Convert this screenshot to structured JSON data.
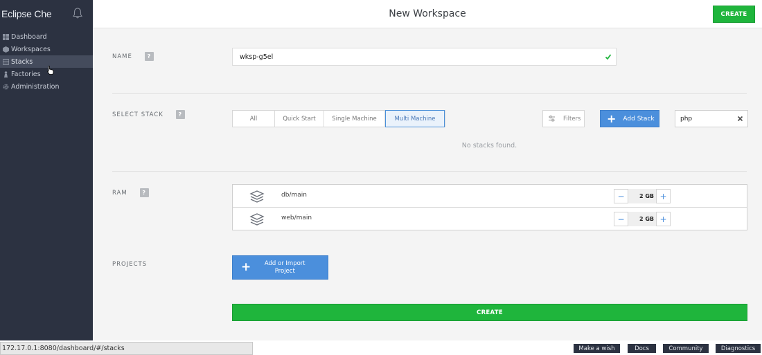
{
  "app": {
    "brand": "Eclipse Che"
  },
  "sidebar": {
    "items": [
      {
        "label": "Dashboard",
        "icon": "dashboard-icon"
      },
      {
        "label": "Workspaces",
        "icon": "workspaces-icon"
      },
      {
        "label": "Stacks",
        "icon": "stacks-icon",
        "active": true
      },
      {
        "label": "Factories",
        "icon": "factories-icon"
      },
      {
        "label": "Administration",
        "icon": "gear-icon"
      }
    ]
  },
  "header": {
    "title": "New Workspace",
    "create_label": "CREATE"
  },
  "name_section": {
    "label": "NAME",
    "help": "?",
    "value": "wksp-g5el"
  },
  "stack_section": {
    "label": "SELECT STACK",
    "help": "?",
    "tabs": [
      "All",
      "Quick Start",
      "Single Machine",
      "Multi Machine"
    ],
    "active_tab": "Multi Machine",
    "filters_label": "Filters",
    "add_stack_label": "Add Stack",
    "search_value": "php",
    "empty_message": "No stacks found."
  },
  "ram_section": {
    "label": "RAM",
    "help": "?",
    "machines": [
      {
        "name": "db/main",
        "ram": "2 GB"
      },
      {
        "name": "web/main",
        "ram": "2 GB"
      }
    ]
  },
  "projects_section": {
    "label": "PROJECTS",
    "add_label": "Add or Import Project"
  },
  "create_label": "CREATE",
  "footer": {
    "url": "172.17.0.1:8080/dashboard/#/stacks",
    "buttons": [
      "Make a wish",
      "Docs",
      "Community",
      "Diagnostics"
    ]
  },
  "colors": {
    "sidebar": "#2c3241",
    "accent_blue": "#4b8fdc",
    "create_green": "#1fb53c"
  }
}
